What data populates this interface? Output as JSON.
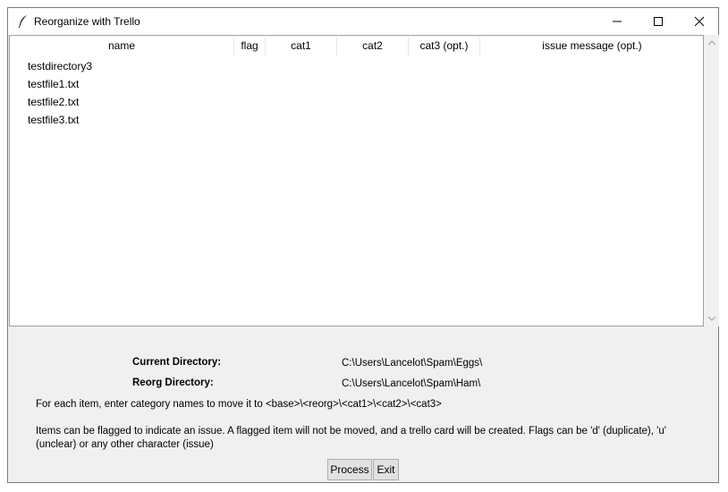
{
  "window": {
    "title": "Reorganize with Trello"
  },
  "icons": {
    "app": "feather-icon",
    "minimize": "minimize-icon",
    "maximize": "maximize-icon",
    "close": "close-icon"
  },
  "table": {
    "columns": [
      "name",
      "flag",
      "cat1",
      "cat2",
      "cat3 (opt.)",
      "issue message (opt.)"
    ],
    "rows": [
      "testdirectory3",
      "testfile1.txt",
      "testfile2.txt",
      "testfile3.txt"
    ]
  },
  "info": {
    "current_label": "Current Directory:",
    "current_value": "C:\\Users\\Lancelot\\Spam\\Eggs\\",
    "reorg_label": "Reorg Directory:",
    "reorg_value": "C:\\Users\\Lancelot\\Spam\\Ham\\",
    "instructions": "For each item, enter category names to move it to <base>\\<reorg>\\<cat1>\\<cat2>\\<cat3>",
    "flags_note": "Items can be flagged to indicate an issue. A flagged item will not be moved, and a trello card will be created. Flags can be 'd' (duplicate), 'u' (unclear) or any other character (issue)"
  },
  "buttons": {
    "process": "Process",
    "exit": "Exit"
  }
}
